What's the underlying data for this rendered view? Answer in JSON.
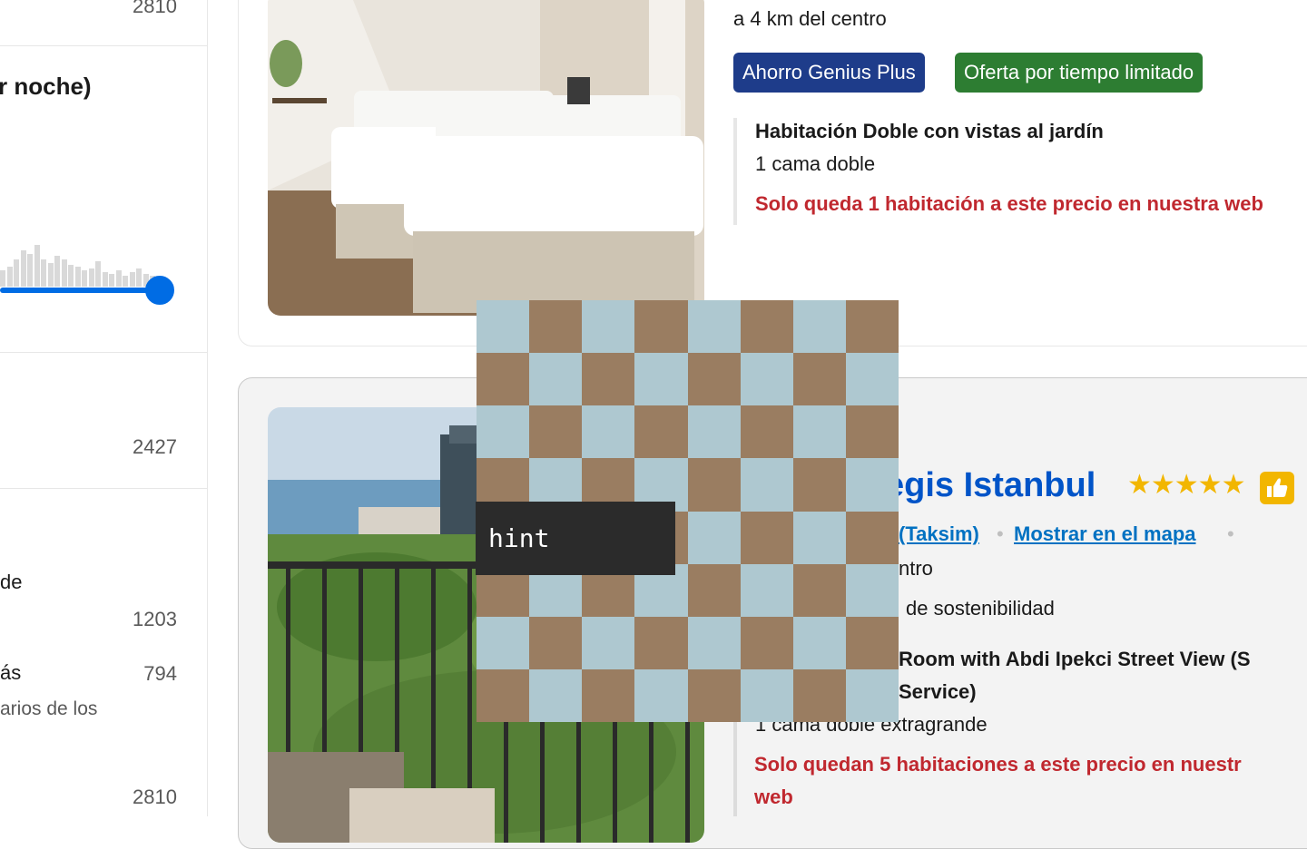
{
  "sidebar": {
    "top_count": "2810",
    "price_heading": "r noche)",
    "count_a": "2427",
    "label_b": "de",
    "count_b": "1203",
    "label_c": "ás",
    "count_c": "794",
    "sub_c": "arios de los",
    "count_d": "2810",
    "price_slider_max_level": 1.0
  },
  "card1": {
    "distance": "a 4 km del centro",
    "badges": [
      {
        "label": "Ahorro Genius Plus",
        "color": "#1e3c8a"
      },
      {
        "label": "Oferta por tiempo limitado",
        "color": "#2d7d32"
      }
    ],
    "room_title": "Habitación Doble con vistas al jardín",
    "bed": "1 cama doble",
    "scarcity": "Solo queda 1 habitación a este precio en nuestra web"
  },
  "card2": {
    "name_partial": "egis Istanbul",
    "stars": 5,
    "star_glyphs": "★★★★★",
    "location_partial": "(Taksim)",
    "map_link": "Mostrar en el mapa",
    "distance_partial": "ntro",
    "sustainability_partial": "de sostenibilidad",
    "room_title_line1": "Room with Abdi Ipekci Street View (S",
    "room_title_line2": "Service)",
    "bed": "1 cama doble extragrande",
    "scarcity_line1": "Solo quedan 5 habitaciones a este precio en nuestr",
    "scarcity_line2": "web"
  },
  "overlay": {
    "hint": "hint"
  },
  "colors": {
    "accent": "#006ce4",
    "genius": "#1e3c8a",
    "deal": "#2d7d32",
    "scarcity": "#c0282f",
    "link": "#0071c2",
    "star": "#f2b600"
  }
}
